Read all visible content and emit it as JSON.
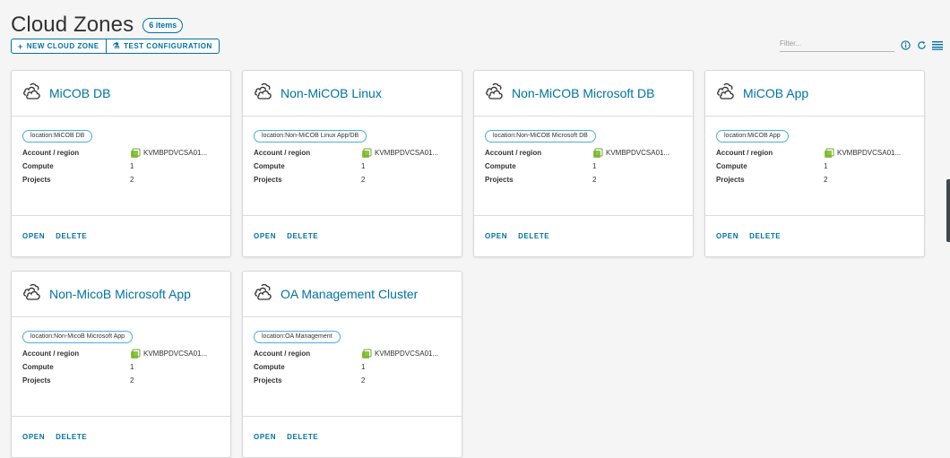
{
  "page": {
    "title": "Cloud Zones",
    "count_badge": "6 items"
  },
  "toolbar": {
    "new_button": {
      "glyph": "+",
      "label": "NEW CLOUD ZONE"
    },
    "test_button": {
      "glyph": "⚗",
      "label": "TEST CONFIGURATION"
    }
  },
  "filter": {
    "placeholder": "Filter..."
  },
  "icons": {
    "info": "info-icon",
    "refresh": "refresh-icon",
    "list_view": "list-view-icon",
    "cloud": "cloud-zone-icon",
    "account": "vsphere-account-icon"
  },
  "labels": {
    "account_region": "Account / region",
    "compute": "Compute",
    "projects": "Projects",
    "open": "OPEN",
    "delete": "DELETE"
  },
  "colors": {
    "accent": "#0072a3",
    "tag_border": "#49afd9",
    "account_icon": "#8cc63f"
  },
  "zones": [
    {
      "name": "MiCOB DB",
      "tag": "location:MiCOB DB",
      "account": "KVMBPDVCSA01...",
      "compute": "1",
      "projects": "2"
    },
    {
      "name": "Non-MiCOB Linux",
      "tag": "location:Non-MiCOB Linux App/DB",
      "account": "KVMBPDVCSA01...",
      "compute": "1",
      "projects": "2"
    },
    {
      "name": "Non-MiCOB Microsoft DB",
      "tag": "location:Non-MiCOB Microsoft DB",
      "account": "KVMBPDVCSA01...",
      "compute": "1",
      "projects": "2"
    },
    {
      "name": "MiCOB App",
      "tag": "location:MiCOB App",
      "account": "KVMBPDVCSA01...",
      "compute": "1",
      "projects": "2"
    },
    {
      "name": "Non-MicoB Microsoft App",
      "tag": "location:Non-MicoB Microsoft App",
      "account": "KVMBPDVCSA01...",
      "compute": "1",
      "projects": "2"
    },
    {
      "name": "OA Management Cluster",
      "tag": "location:OA Management",
      "account": "KVMBPDVCSA01...",
      "compute": "1",
      "projects": "2"
    }
  ]
}
